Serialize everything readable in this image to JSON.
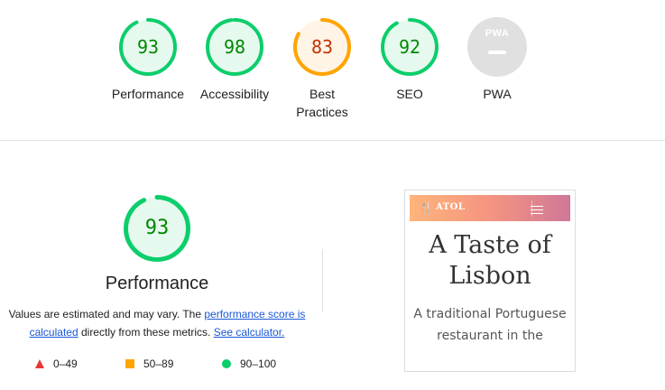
{
  "gauges": [
    {
      "label": "Performance",
      "score": "93",
      "fraction": 0.93,
      "status": "pass"
    },
    {
      "label": "Accessibility",
      "score": "98",
      "fraction": 0.98,
      "status": "pass"
    },
    {
      "label": "Best Practices",
      "score": "83",
      "fraction": 0.83,
      "status": "average"
    },
    {
      "label": "SEO",
      "score": "92",
      "fraction": 0.92,
      "status": "pass"
    },
    {
      "label": "PWA",
      "badge": "PWA"
    }
  ],
  "performance": {
    "score": "93",
    "fraction": 0.93,
    "title": "Performance",
    "desc_1": "Values are estimated and may vary. The ",
    "link_1": "performance score is calculated",
    "desc_2": " directly from these metrics. ",
    "link_2": "See calculator."
  },
  "legend": [
    {
      "range": "0–49",
      "shape": "triangle",
      "color": "#e53935"
    },
    {
      "range": "50–89",
      "shape": "square",
      "color": "#ffa400"
    },
    {
      "range": "90–100",
      "shape": "circle",
      "color": "#0cce6b"
    }
  ],
  "screenshot": {
    "brand": "ATOL",
    "title": "A Taste of Lisbon",
    "subtitle": "A traditional Portuguese restaurant in the"
  },
  "colors": {
    "pass": "#0cce6b",
    "pass_text": "#008800",
    "pass_fill": "#e6f9ef",
    "average": "#ffa400",
    "average_text": "#c33300",
    "average_fill": "#fff4e5"
  }
}
